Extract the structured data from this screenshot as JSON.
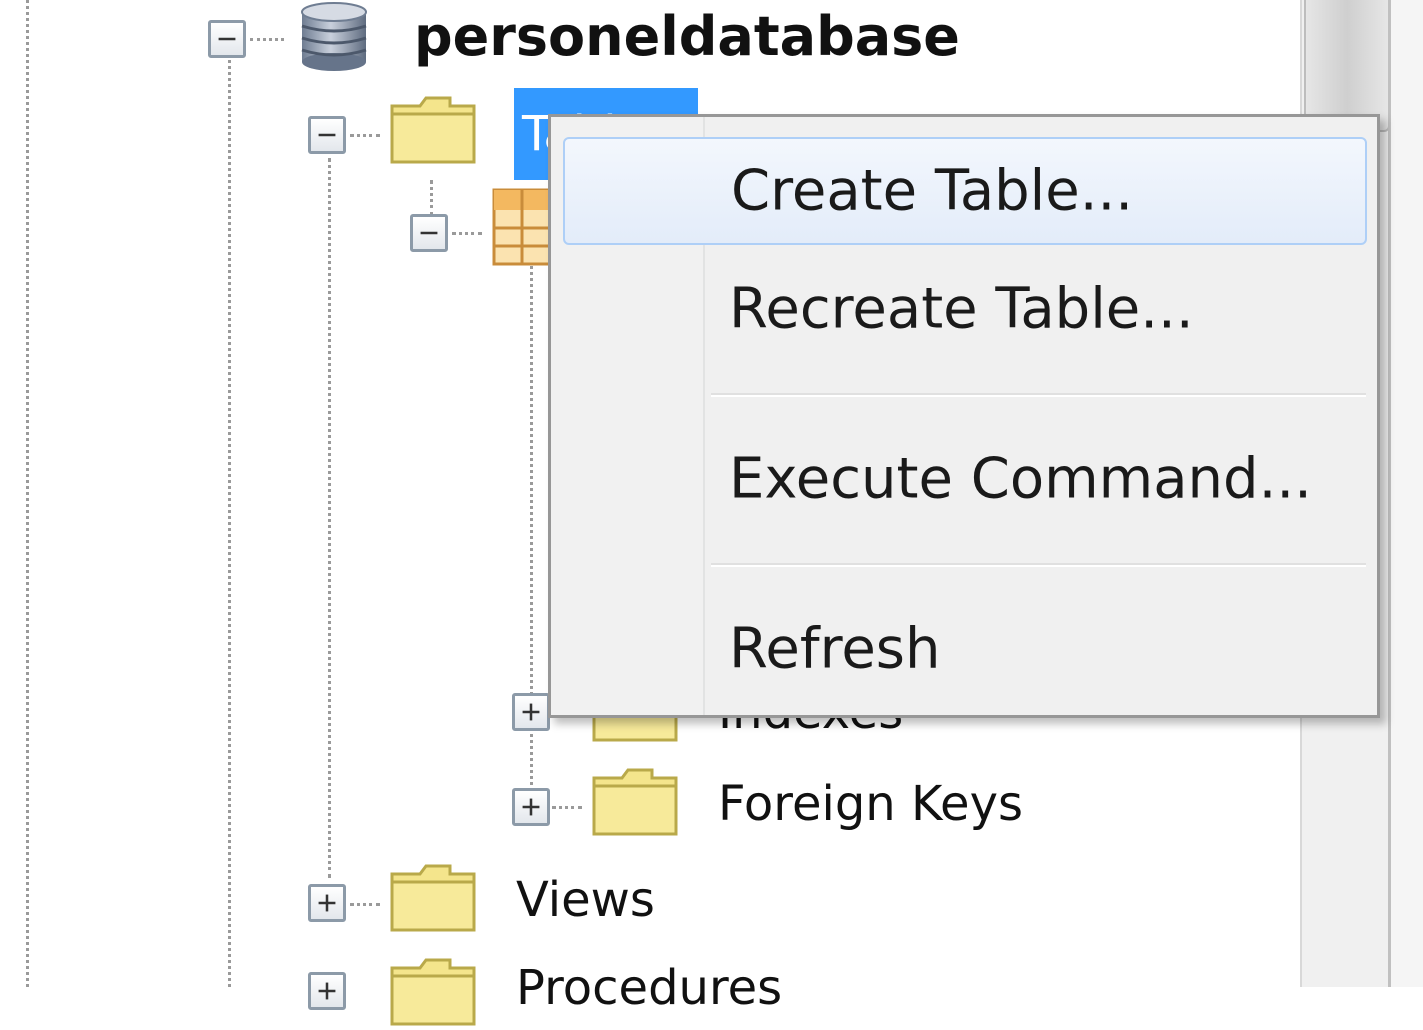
{
  "tree": {
    "database": {
      "label": "personeldatabase",
      "icon": "database-icon"
    },
    "tables_folder": {
      "label": "Tables",
      "icon": "folder-icon",
      "selected": true
    },
    "table_node": {
      "icon": "table-icon"
    },
    "indexes_folder": {
      "label": "Indexes",
      "icon": "folder-icon"
    },
    "foreign_keys_folder": {
      "label": "Foreign Keys",
      "icon": "folder-icon"
    },
    "views_folder": {
      "label": "Views",
      "icon": "folder-icon"
    },
    "procedures_folder": {
      "label": "Procedures",
      "icon": "folder-icon"
    }
  },
  "context_menu": {
    "items": [
      {
        "label": "Create Table...",
        "highlighted": true
      },
      {
        "label": "Recreate Table..."
      },
      {
        "label": "Execute Command..."
      },
      {
        "label": "Refresh"
      }
    ]
  },
  "colors": {
    "selection": "#3399ff",
    "folder": "#f4e58c",
    "menu_background": "#f0f0f0",
    "menu_highlight_border": "#aecff7"
  }
}
